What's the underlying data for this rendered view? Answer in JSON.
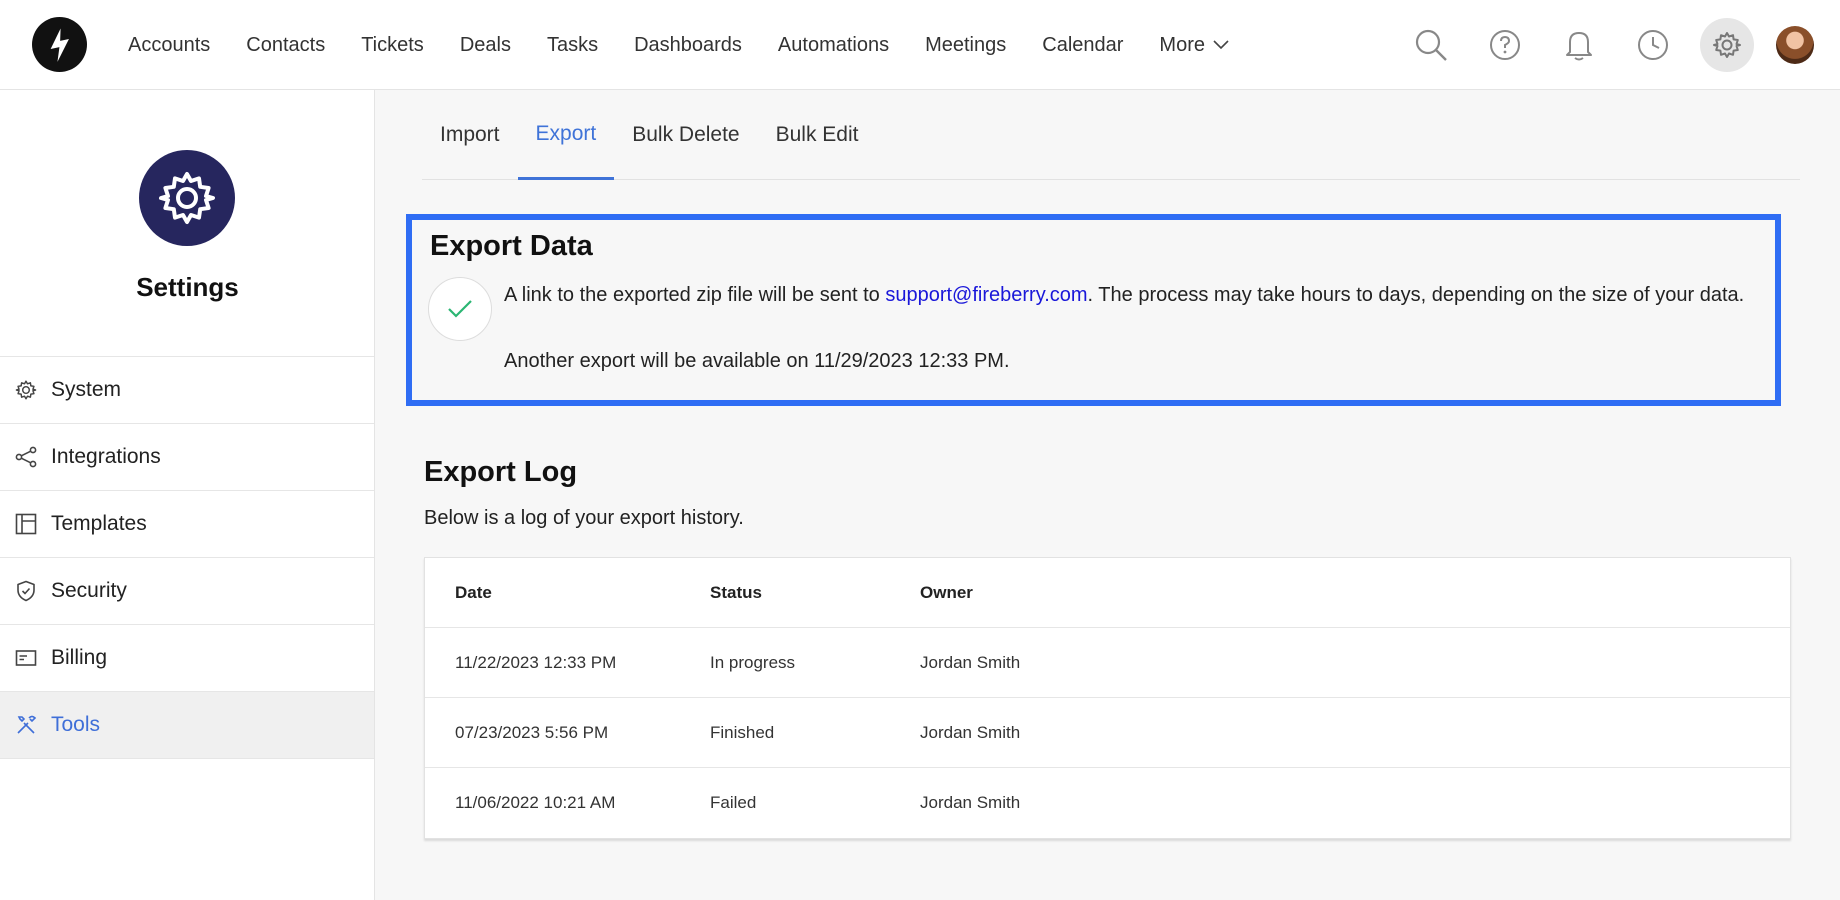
{
  "nav": {
    "items": [
      "Accounts",
      "Contacts",
      "Tickets",
      "Deals",
      "Tasks",
      "Dashboards",
      "Automations",
      "Meetings",
      "Calendar"
    ],
    "more_label": "More",
    "icons": [
      "search-icon",
      "help-icon",
      "bell-icon",
      "clock-icon",
      "gear-icon"
    ]
  },
  "sidebar": {
    "title": "Settings",
    "items": [
      {
        "label": "System",
        "icon": "gear-icon"
      },
      {
        "label": "Integrations",
        "icon": "share-icon"
      },
      {
        "label": "Templates",
        "icon": "layout-icon"
      },
      {
        "label": "Security",
        "icon": "shield-icon"
      },
      {
        "label": "Billing",
        "icon": "card-icon"
      },
      {
        "label": "Tools",
        "icon": "tools-icon",
        "active": true
      }
    ]
  },
  "tabs": [
    {
      "label": "Import"
    },
    {
      "label": "Export",
      "active": true
    },
    {
      "label": "Bulk Delete"
    },
    {
      "label": "Bulk Edit"
    }
  ],
  "export": {
    "title": "Export Data",
    "msg_prefix": "A link to the exported zip file will be sent to ",
    "email": "support@fireberry.com",
    "msg_suffix": ". The process may take hours to days, depending on the size of your data.",
    "next": "Another export will be available on 11/29/2023 12:33 PM."
  },
  "log": {
    "title": "Export Log",
    "subtitle": "Below is a log of your export history.",
    "columns": [
      "Date",
      "Status",
      "Owner"
    ],
    "rows": [
      [
        "11/22/2023 12:33 PM",
        "In progress",
        "Jordan Smith"
      ],
      [
        "07/23/2023 5:56 PM",
        "Finished",
        "Jordan Smith"
      ],
      [
        "11/06/2022 10:21 AM",
        "Failed",
        "Jordan Smith"
      ]
    ]
  },
  "colors": {
    "accent": "#3f73d8",
    "highlight": "#2f6df4",
    "sidebar_gear_bg": "#26265e",
    "check": "#2bb673"
  }
}
